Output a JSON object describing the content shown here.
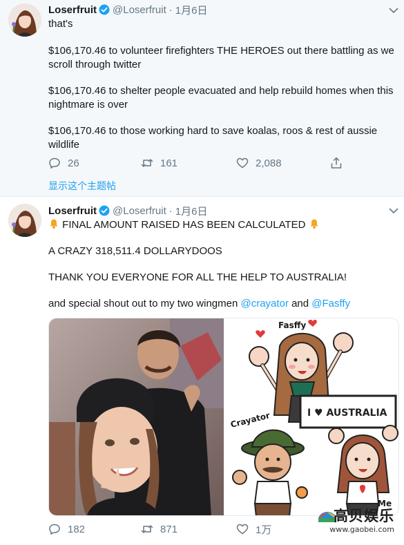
{
  "tweets": [
    {
      "name": "Loserfruit",
      "handle": "@Loserfruit",
      "dot": "·",
      "date": "1月6日",
      "paragraphs": [
        "that's",
        "$106,170.46 to volunteer firefighters THE HEROES out there battling as we scroll through twitter",
        "$106,170.46 to shelter people evacuated and help rebuild homes when this nightmare is over",
        "$106,170.46 to those working hard to save koalas, roos & rest of aussie wildlife"
      ],
      "replies": "26",
      "retweets": "161",
      "likes": "2,088",
      "thread_link": "显示这个主题帖"
    },
    {
      "name": "Loserfruit",
      "handle": "@Loserfruit",
      "dot": "·",
      "date": "1月6日",
      "line1": "FINAL AMOUNT RAISED HAS BEEN CALCULATED",
      "line2": "A CRAZY 318,511.4 DOLLARYDOOS",
      "line3": "THANK YOU EVERYONE FOR ALL THE HELP TO AUSTRALIA!",
      "line4_prefix": "and special shout out to my two wingmen ",
      "mention1": "@crayator",
      "line4_mid": " and ",
      "mention2": "@Fasffy",
      "replies": "182",
      "retweets": "871",
      "likes": "1万"
    }
  ],
  "illustration_labels": {
    "fasffy": "Fasffy",
    "crayator": "Crayator",
    "sign": "I ♥ AUSTRALIA",
    "me": "Me"
  },
  "watermark": {
    "text": "高贝娱乐",
    "url": "www.gaobei.com"
  },
  "colors": {
    "accent": "#1da1f2",
    "muted": "#657786",
    "text": "#14171a",
    "tweet1_bg": "#f5f8fa"
  },
  "icons": [
    "verified-badge-icon",
    "chevron-down-icon",
    "reply-icon",
    "retweet-icon",
    "like-icon",
    "share-icon",
    "bell-icon"
  ]
}
